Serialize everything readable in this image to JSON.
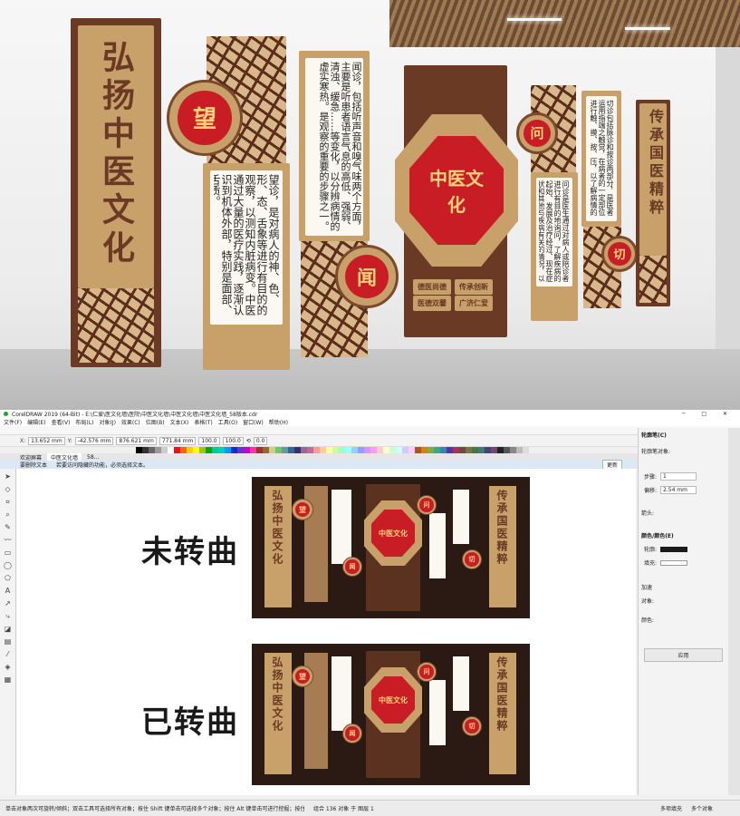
{
  "render": {
    "left_banner": "弘扬中医文化",
    "right_banner": "传承国医精粹",
    "roundel_wang": "望",
    "roundel_wen1": "闻",
    "roundel_wen2": "问",
    "roundel_qie": "切",
    "center_logo": "中医文化",
    "text_wang": "望诊，是对病人的神、色、形、态、舌象等进行有目的的观察，以测知内脏病变。中医通过大量的医疗实践，逐渐认识到机体外部，特别是面部、舌质。",
    "text_wen": "闻诊，包括听声音和嗅气味两个方面，主要是听患者语言气息的高低、强弱、清浊、缓急……等变化，以分辨病情的虚实寒热。是观察的重要的步骤之一。",
    "text_wen2": "问诊是医生通过对病人或陪诊者进行有目的地询问，了解疾病的起始、发展及治疗经过、现在症状和其他与疾病有关的情况，以诊察疾病的方法。",
    "text_qie": "切诊包括脉诊和按诊两部分，是医者运用指端之触觉，在病者的一定部位进行触、摸、按、压，以了解病情的方法。",
    "buttons": [
      "德医尚德",
      "传承创新",
      "医德双馨",
      "广济仁爱"
    ]
  },
  "app": {
    "title": "CorelDRAW 2019 (64-Bit) - E:\\仁爱\\医文化墙\\医院\\中医文化墙\\中医文化墙\\中医文化墙_58版本.cdr",
    "menu": [
      "文件(F)",
      "编辑(E)",
      "查看(V)",
      "布局(L)",
      "对象(J)",
      "效果(C)",
      "位图(B)",
      "文本(X)",
      "表格(T)",
      "工具(O)",
      "窗口(W)",
      "帮助(H)"
    ],
    "prop": {
      "x": "13.652 mm",
      "y": "-42.576 mm",
      "w": "876.621 mm",
      "h": "771.84 mm",
      "sx": "100.0",
      "sy": "100.0",
      "angle": "0.0"
    },
    "tabs": [
      "欢迎屏幕",
      "中医文化墙",
      "58..."
    ],
    "hint_left": "要删除文本",
    "hint_text": "若要访问隐藏的功能，必须选择文本。",
    "hint_right": "更新",
    "canvas_label_top": "未转曲",
    "canvas_label_bottom": "已转曲",
    "docker": {
      "title": "轮廓笔(C)",
      "section1": "轮廓笔对象:",
      "width_label": "步骤:",
      "width_val": "1",
      "spacing_label": "偏移:",
      "spacing_val": "2.54 mm",
      "corner_label": "箭头:",
      "color_section": "颜色/颜色(E)",
      "outline_label": "轮廓:",
      "fill_label": "填充:",
      "extra_label": "加速",
      "obj_label": "对象:",
      "color_label": "颜色:",
      "apply_btn": "应用"
    },
    "status": {
      "left": "单击对象两次可旋转/倾斜；双击工具可选择所有对象；按住 Shift 键单击可选择多个对象；按住 Alt 键单击可进行挖掘；按住 Ctrl 并单击可在组中选择",
      "objects": "组合 136 对象 于 图层 1",
      "fill": "多项填充",
      "outline": "多个对象"
    }
  }
}
